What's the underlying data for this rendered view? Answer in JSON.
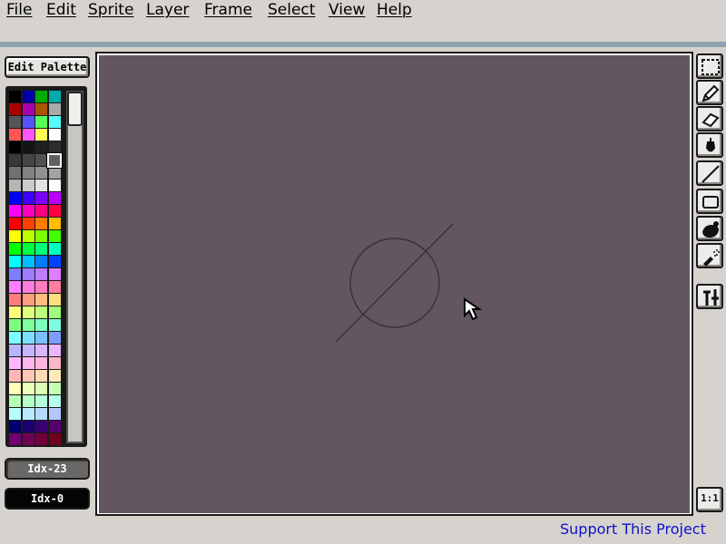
{
  "menu": {
    "file": "File",
    "edit": "Edit",
    "sprite": "Sprite",
    "layer": "Layer",
    "frame": "Frame",
    "select": "Select",
    "view": "View",
    "help": "Help"
  },
  "palette": {
    "edit_button": "Edit Palette",
    "foreground_index": "Idx-23",
    "background_index": "Idx-0",
    "colors": [
      "#000000",
      "#0000aa",
      "#00aa00",
      "#00aaaa",
      "#aa0000",
      "#aa00aa",
      "#aa5500",
      "#aaaaaa",
      "#555555",
      "#5555ff",
      "#55ff55",
      "#55ffff",
      "#ff5555",
      "#ff55ff",
      "#ffff55",
      "#ffffff",
      "#000000",
      "#141414",
      "#202020",
      "#2c2c2c",
      "#383838",
      "#454545",
      "#515151",
      "#616161",
      "#717171",
      "#828282",
      "#929292",
      "#a2a2a2",
      "#b6b6b6",
      "#cacaca",
      "#e2e2e2",
      "#ffffff",
      "#0000ff",
      "#4100ff",
      "#7d00ff",
      "#be00ff",
      "#ff00ff",
      "#ff00be",
      "#ff007d",
      "#ff0041",
      "#ff0000",
      "#ff4100",
      "#ff7d00",
      "#ffbe00",
      "#ffff00",
      "#beff00",
      "#7dff00",
      "#41ff00",
      "#00ff00",
      "#00ff41",
      "#00ff7d",
      "#00ffbe",
      "#00ffff",
      "#00beff",
      "#007dff",
      "#0041ff",
      "#7d7dff",
      "#9e7dff",
      "#be7dff",
      "#df7dff",
      "#ff7dff",
      "#ff7ddf",
      "#ff7dbe",
      "#ff7d9e",
      "#ff7d7d",
      "#ff9e7d",
      "#ffbe7d",
      "#ffdf7d",
      "#ffff7d",
      "#dfff7d",
      "#beff7d",
      "#9eff7d",
      "#7dff7d",
      "#7dff9e",
      "#7dffbe",
      "#7dffdf",
      "#7dffff",
      "#7ddfff",
      "#7dbeff",
      "#7d9eff",
      "#b6b6ff",
      "#c6b6ff",
      "#dbb6ff",
      "#ebb6ff",
      "#ffb6ff",
      "#ffb6eb",
      "#ffb6db",
      "#ffb6c6",
      "#ffb6b6",
      "#ffc6b6",
      "#ffdbb6",
      "#ffebb6",
      "#ffffb6",
      "#ebffb6",
      "#dbffb6",
      "#c6ffb6",
      "#b6ffb6",
      "#b6ffc6",
      "#b6ffdb",
      "#b6ffeb",
      "#b6ffff",
      "#b6ebff",
      "#b6dbff",
      "#b6c6ff",
      "#000071",
      "#1c0071",
      "#380071",
      "#550071",
      "#710071",
      "#710055",
      "#710038",
      "#71001c"
    ],
    "selected_index": 23
  },
  "tools": [
    "rectangular-marquee-icon",
    "pencil-icon",
    "eraser-icon",
    "eyedropper-icon",
    "line-icon",
    "rectangle-icon",
    "paint-bucket-icon",
    "spray-icon",
    "configure-tools-icon",
    "zoom-actual-icon"
  ],
  "zoom_button": "1:1",
  "status": {
    "support_link": "Support This Project"
  },
  "colors": {
    "canvas": "#645660",
    "link": "#1010c8",
    "separator": "#8ea2b0"
  }
}
